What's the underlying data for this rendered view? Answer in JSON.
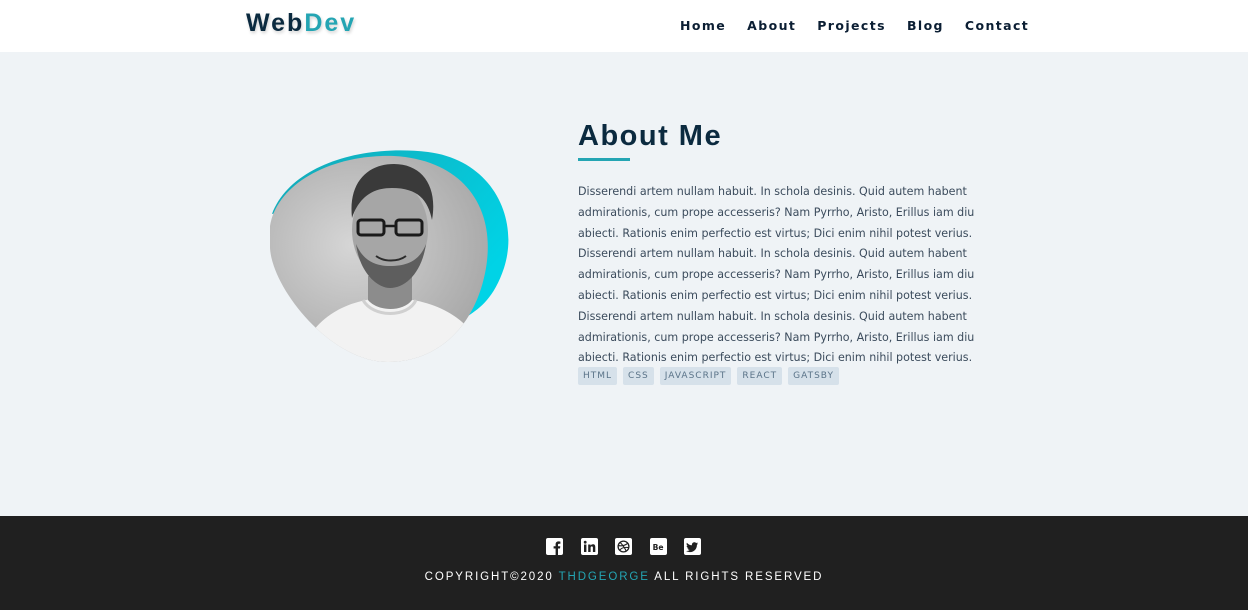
{
  "header": {
    "logo_part1": "Web",
    "logo_part2": "Dev",
    "nav": [
      "Home",
      "About",
      "Projects",
      "Blog",
      "Contact"
    ]
  },
  "about": {
    "title": "About Me",
    "paragraph": "Disserendi artem nullam habuit. In schola desinis. Quid autem habent admirationis, cum prope accesseris? Nam Pyrrho, Aristo, Erillus iam diu abiecti. Rationis enim perfectio est virtus; Dici enim nihil potest verius. Disserendi artem nullam habuit. In schola desinis. Quid autem habent admirationis, cum prope accesseris? Nam Pyrrho, Aristo, Erillus iam diu abiecti. Rationis enim perfectio est virtus; Dici enim nihil potest verius. Disserendi artem nullam habuit. In schola desinis. Quid autem habent admirationis, cum prope accesseris? Nam Pyrrho, Aristo, Erillus iam diu abiecti. Rationis enim perfectio est virtus; Dici enim nihil potest verius.",
    "tags": [
      "HTML",
      "CSS",
      "JAVASCRIPT",
      "REACT",
      "GATSBY"
    ],
    "photo": "profile-photo"
  },
  "footer": {
    "socials": [
      "facebook-icon",
      "linkedin-icon",
      "dribbble-icon",
      "behance-icon",
      "twitter-icon"
    ],
    "copyright_prefix": "COPYRIGHT©2020 ",
    "copyright_name": "THDGEORGE",
    "copyright_suffix": " ALL RIGHTS RESERVED"
  },
  "colors": {
    "accent": "#24a5b3",
    "dark": "#0b2a3f",
    "page_bg": "#eff3f6",
    "footer_bg": "#202020"
  }
}
